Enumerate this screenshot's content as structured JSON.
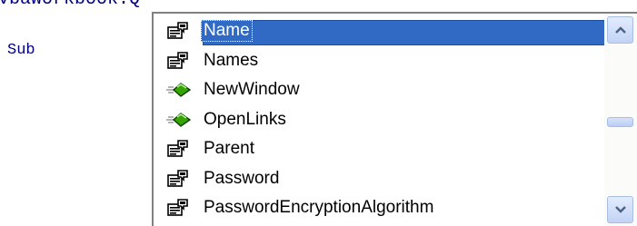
{
  "editor": {
    "top_line": "vbaWorkbook.Q",
    "sub_keyword": "Sub"
  },
  "autocomplete": {
    "selected_index": 0,
    "items": [
      {
        "label": "Name",
        "kind": "property",
        "icon": "property-icon"
      },
      {
        "label": "Names",
        "kind": "property",
        "icon": "property-icon"
      },
      {
        "label": "NewWindow",
        "kind": "method",
        "icon": "method-icon"
      },
      {
        "label": "OpenLinks",
        "kind": "method",
        "icon": "method-icon"
      },
      {
        "label": "Parent",
        "kind": "property",
        "icon": "property-icon"
      },
      {
        "label": "Password",
        "kind": "property",
        "icon": "property-icon"
      },
      {
        "label": "PasswordEncryptionAlgorithm",
        "kind": "property",
        "icon": "property-icon"
      }
    ]
  },
  "scrollbar": {
    "up_icon": "chevron-up-icon",
    "down_icon": "chevron-down-icon"
  },
  "colors": {
    "selection": "#316ac5",
    "code_keyword": "#000080"
  }
}
